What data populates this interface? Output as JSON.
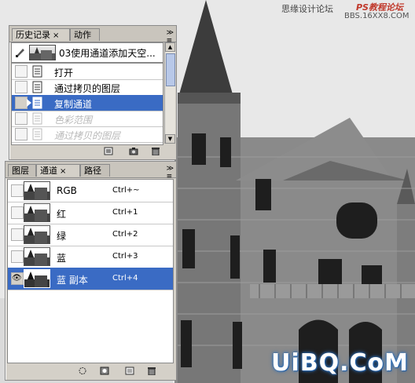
{
  "watermark": {
    "top_right_line1": "思缘设计论坛",
    "top_right_brand": "PS教程论坛",
    "top_right_url": "BBS.16XX8.COM",
    "logo": "UiBQ.CoM"
  },
  "history_panel": {
    "tabs": [
      {
        "label": "历史记录",
        "close": "×"
      },
      {
        "label": "动作"
      }
    ],
    "menu_icon": "panel-menu-icon",
    "snapshot": {
      "label": "03使用通道添加天空..."
    },
    "items": [
      {
        "label": "打开",
        "state": "normal"
      },
      {
        "label": "通过拷贝的图层",
        "state": "normal"
      },
      {
        "label": "复制通道",
        "state": "selected"
      },
      {
        "label": "色彩范围",
        "state": "dimmed"
      },
      {
        "label": "通过拷贝的图层",
        "state": "dimmed"
      }
    ],
    "footer_icons": [
      "new-document-from-state-icon",
      "new-snapshot-icon",
      "delete-icon"
    ]
  },
  "channels_panel": {
    "tabs": [
      {
        "label": "图层"
      },
      {
        "label": "通道",
        "close": "×"
      },
      {
        "label": "路径"
      }
    ],
    "menu_icon": "panel-menu-icon",
    "channels": [
      {
        "name": "RGB",
        "shortcut": "Ctrl+~",
        "visible": false,
        "selected": false
      },
      {
        "name": "红",
        "shortcut": "Ctrl+1",
        "visible": false,
        "selected": false
      },
      {
        "name": "绿",
        "shortcut": "Ctrl+2",
        "visible": false,
        "selected": false
      },
      {
        "name": "蓝",
        "shortcut": "Ctrl+3",
        "visible": false,
        "selected": false
      },
      {
        "name": "蓝 副本",
        "shortcut": "Ctrl+4",
        "visible": true,
        "selected": true
      }
    ],
    "footer_icons": [
      "load-selection-icon",
      "save-selection-icon",
      "new-channel-icon",
      "delete-channel-icon"
    ]
  }
}
